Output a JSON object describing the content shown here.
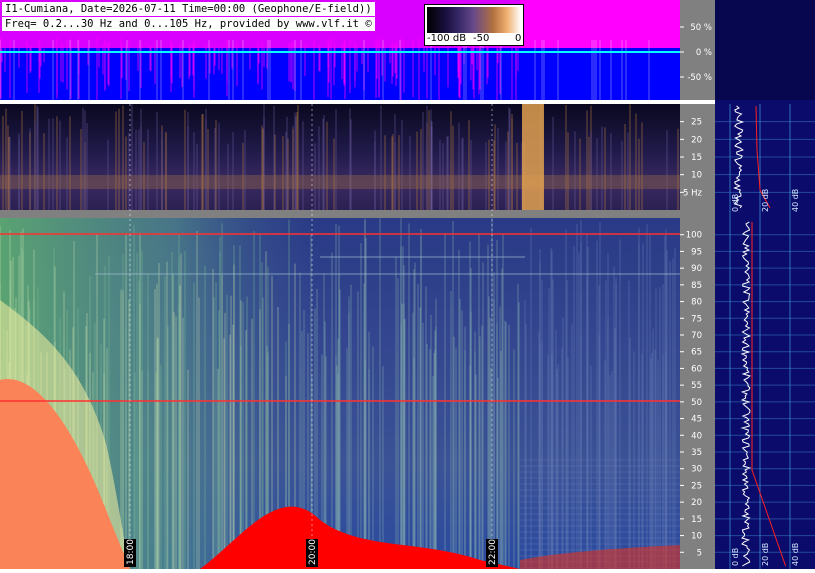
{
  "header": {
    "line1": "I1-Cumiana, Date=2026-07-11 Time=00:00 (Geophone/E-field))",
    "line2": "Freq= 0.2...30 Hz and 0...105 Hz, provided by www.vlf.it ©"
  },
  "colorbar": {
    "labels": [
      "-100 dB",
      "-50",
      "0"
    ]
  },
  "chart_data": [
    {
      "type": "area",
      "name": "waveform",
      "y_ticks": [
        "50 %",
        "0 %",
        "-50 %"
      ],
      "y_values": [
        50,
        0,
        -50
      ],
      "ylim": [
        -100,
        100
      ],
      "colors": {
        "background": "#0000ff",
        "trace": "#ff00ff",
        "center": "#00ffff"
      }
    },
    {
      "type": "heatmap",
      "name": "low-frequency spectrogram",
      "y_ticks": [
        "25",
        "20",
        "15",
        "10",
        "5 Hz"
      ],
      "y_values": [
        25,
        20,
        15,
        10,
        5
      ],
      "ylim": [
        0,
        30
      ],
      "side_spectrum_ticks": [
        "0 dB",
        "20 dB",
        "40 dB"
      ]
    },
    {
      "type": "heatmap",
      "name": "high-frequency spectrogram",
      "y_ticks": [
        "100",
        "95",
        "90",
        "85",
        "80",
        "75",
        "70",
        "65",
        "60",
        "55",
        "50",
        "45",
        "40",
        "35",
        "30",
        "25",
        "20",
        "15",
        "10",
        "5"
      ],
      "y_values": [
        100,
        95,
        90,
        85,
        80,
        75,
        70,
        65,
        60,
        55,
        50,
        45,
        40,
        35,
        30,
        25,
        20,
        15,
        10,
        5
      ],
      "ylim": [
        0,
        105
      ],
      "time_labels": [
        "18:00",
        "20:00",
        "22:00"
      ],
      "side_spectrum_ticks": [
        "0 dB",
        "20 dB",
        "40 dB"
      ],
      "lines_hz": [
        50,
        100
      ]
    }
  ]
}
